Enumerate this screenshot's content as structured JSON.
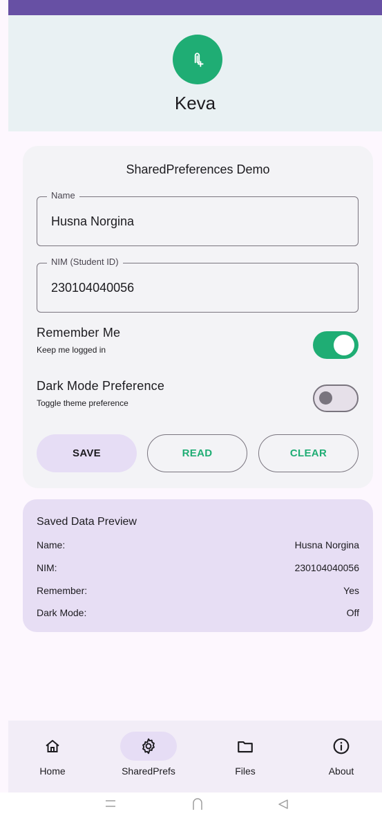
{
  "app": {
    "title": "Keva",
    "logo_icon": "paperclip-add-icon",
    "brand_color": "#1fad74",
    "accent_color": "#6750a4"
  },
  "card": {
    "title": "SharedPreferences Demo",
    "name_field": {
      "label": "Name",
      "value": "Husna Norgina"
    },
    "nim_field": {
      "label": "NIM (Student ID)",
      "value": "230104040056"
    },
    "remember": {
      "title": "Remember Me",
      "subtitle": "Keep me logged in",
      "on": true
    },
    "dark_mode": {
      "title": "Dark Mode Preference",
      "subtitle": "Toggle theme preference",
      "on": false
    },
    "buttons": {
      "save": "SAVE",
      "read": "READ",
      "clear": "CLEAR"
    }
  },
  "preview": {
    "title": "Saved Data Preview",
    "rows": [
      {
        "key": "Name:",
        "value": "Husna Norgina"
      },
      {
        "key": "NIM:",
        "value": "230104040056"
      },
      {
        "key": "Remember:",
        "value": "Yes"
      },
      {
        "key": "Dark Mode:",
        "value": "Off"
      }
    ]
  },
  "bottom_nav": {
    "items": [
      {
        "label": "Home",
        "icon": "home-icon",
        "active": false
      },
      {
        "label": "SharedPrefs",
        "icon": "gear-icon",
        "active": true
      },
      {
        "label": "Files",
        "icon": "folder-icon",
        "active": false
      },
      {
        "label": "About",
        "icon": "info-icon",
        "active": false
      }
    ]
  },
  "system_nav": {
    "icons": [
      "recents-icon",
      "home-button-icon",
      "back-icon"
    ]
  }
}
